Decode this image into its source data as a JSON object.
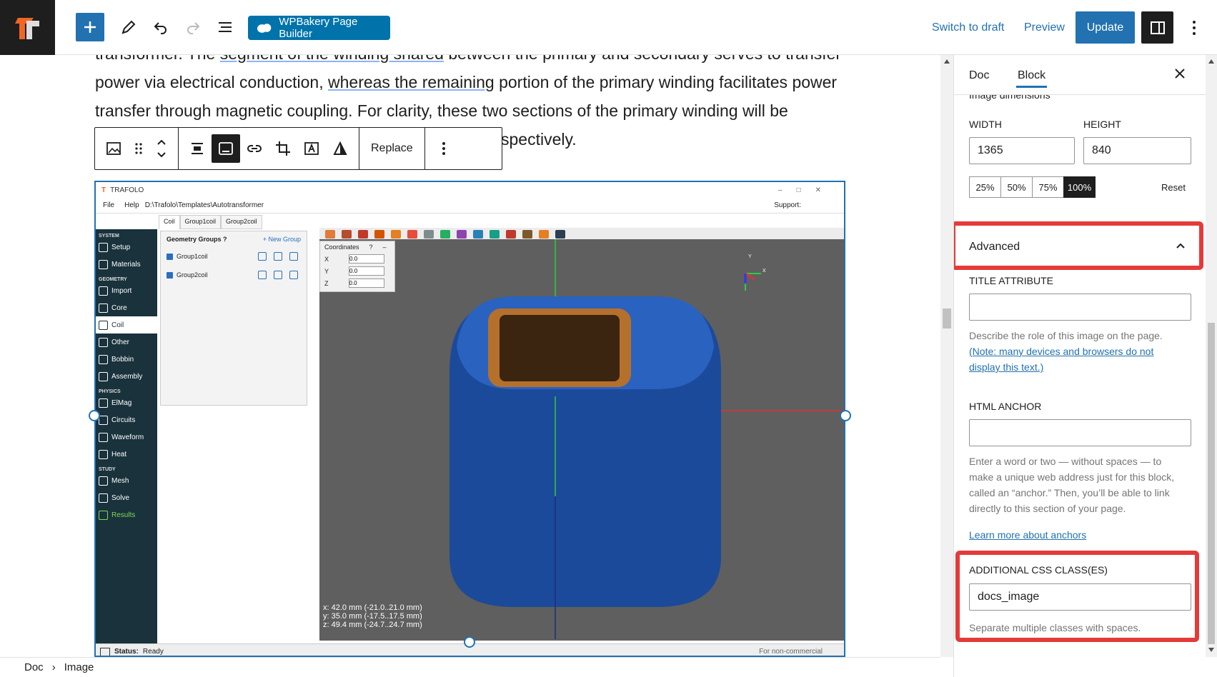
{
  "topbar": {
    "wpbakery_label": "WPBakery Page Builder",
    "switch_draft": "Switch to draft",
    "preview": "Preview",
    "update": "Update"
  },
  "content": {
    "line1_a": "transformer. The ",
    "line1_b": "segment of the winding shared",
    "line1_c": " between the primary and secondary serves to transfer",
    "line2_a": "power via electrical conduction, ",
    "line2_b": "whereas the remaining",
    "line2_c": " portion of the primary winding facilitates power",
    "line3": "transfer through magnetic coupling. For clarity, these two sections of the primary winding will be",
    "line4_tail": "spectively."
  },
  "block_toolbar": {
    "replace": "Replace"
  },
  "app": {
    "title": "TRAFOLO",
    "menu_file": "File",
    "menu_help": "Help",
    "path": "D:\\Trafolo\\Templates\\Autotransformer",
    "support": "Support:",
    "sidebar": [
      {
        "type": "h",
        "label": "SYSTEM"
      },
      {
        "type": "i",
        "label": "Setup"
      },
      {
        "type": "i",
        "label": "Materials"
      },
      {
        "type": "h",
        "label": "GEOMETRY"
      },
      {
        "type": "i",
        "label": "Import"
      },
      {
        "type": "i",
        "label": "Core"
      },
      {
        "type": "i",
        "label": "Coil",
        "sel": true
      },
      {
        "type": "i",
        "label": "Other"
      },
      {
        "type": "i",
        "label": "Bobbin"
      },
      {
        "type": "i",
        "label": "Assembly"
      },
      {
        "type": "h",
        "label": "PHYSICS"
      },
      {
        "type": "i",
        "label": "ElMag"
      },
      {
        "type": "i",
        "label": "Circuits"
      },
      {
        "type": "i",
        "label": "Waveform"
      },
      {
        "type": "i",
        "label": "Heat"
      },
      {
        "type": "h",
        "label": "STUDY"
      },
      {
        "type": "i",
        "label": "Mesh"
      },
      {
        "type": "i",
        "label": "Solve"
      },
      {
        "type": "i",
        "label": "Results",
        "green": true
      }
    ],
    "tabs": [
      "Coil",
      "Group1coil",
      "Group2coil"
    ],
    "geometry_groups": "Geometry Groups",
    "help_q": "?",
    "new_group": "+ New Group",
    "groups": [
      "Group1coil",
      "Group2coil"
    ],
    "coordinates": "Coordinates",
    "coord_rows": [
      {
        "k": "X",
        "v": "0.0"
      },
      {
        "k": "Y",
        "v": "0.0"
      },
      {
        "k": "Z",
        "v": "0.0"
      }
    ],
    "axis_y": "Y",
    "axis_x": "X",
    "dims": [
      "x: 42.0 mm (-21.0..21.0 mm)",
      "y: 35.0 mm (-17.5..17.5 mm)",
      "z: 49.4 mm (-24.7..24.7 mm)"
    ],
    "status_label": "Status:",
    "status_value": "Ready",
    "noncommercial": "For non-commercial"
  },
  "breadcrumb": {
    "root": "Doc",
    "current": "Image"
  },
  "sidebar": {
    "tab_doc": "Doc",
    "tab_block": "Block",
    "image_dimensions": "Image dimensions",
    "width_label": "WIDTH",
    "height_label": "HEIGHT",
    "width_value": "1365",
    "height_value": "840",
    "percents": [
      "25%",
      "50%",
      "75%",
      "100%"
    ],
    "reset": "Reset",
    "advanced": "Advanced",
    "title_attr_label": "TITLE ATTRIBUTE",
    "title_attr_help": "Describe the role of this image on the page.",
    "title_attr_link": "(Note: many devices and browsers do not display this text.)",
    "html_anchor_label": "HTML ANCHOR",
    "anchor_help": "Enter a word or two — without spaces — to make a unique web address just for this block, called an “anchor.” Then, you’ll be able to link directly to this section of your page.",
    "anchor_link": "Learn more about anchors",
    "css_label": "ADDITIONAL CSS CLASS(ES)",
    "css_value": "docs_image",
    "css_help": "Separate multiple classes with spaces."
  }
}
